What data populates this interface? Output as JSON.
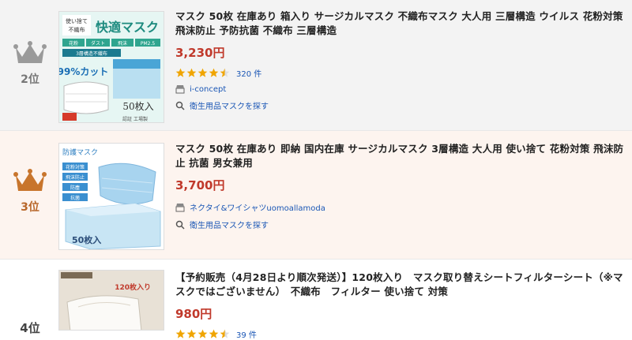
{
  "items": [
    {
      "rank_label": "2位",
      "title": "マスク 50枚 在庫あり 箱入り サージカルマスク 不織布マスク 大人用 三層構造 ウイルス 花粉対策 飛沫防止 予防抗菌 不織布 三層構造",
      "price": "3,230円",
      "rating": 4.5,
      "review_count": "320 件",
      "shop": "i-concept",
      "category_link": "衛生用品マスクを探す",
      "thumb": {
        "line1": "使い捨て",
        "line2": "不織布",
        "big": "快適マスク",
        "tags": [
          "花粉",
          "ダスト",
          "飛沫",
          "PM2.5"
        ],
        "band": "3層構造不織布",
        "percent": "99%カット",
        "count": "50枚入",
        "foot": "認証 工場製"
      }
    },
    {
      "rank_label": "3位",
      "title": "マスク 50枚 在庫あり 即納 国内在庫 サージカルマスク 3層構造 大人用 使い捨て 花粉対策 飛沫防止 抗菌 男女兼用",
      "price": "3,700円",
      "rating": 0,
      "review_count": "",
      "shop": "ネクタイ&ワイシャツuomoallamoda",
      "category_link": "衛生用品マスクを探す",
      "thumb": {
        "header": "防護マスク",
        "tags": [
          "花粉対策",
          "飛沫防止",
          "防塵",
          "抗菌"
        ],
        "count": "50枚入"
      }
    },
    {
      "rank_label": "4位",
      "title": "【予約販売（4月28日より順次発送）】120枚入り　マスク取り替えシートフィルターシート（※マスクではございません）　不織布　フィルター 使い捨て 対策",
      "price": "980円",
      "rating": 4.5,
      "review_count": "39 件",
      "thumb": {
        "count": "120枚入り"
      }
    }
  ],
  "colors": {
    "price": "#c0392b",
    "link": "#1a56b5",
    "star": "#f0a500",
    "crown_silver": "#9a9a9a",
    "crown_bronze": "#c8752c"
  }
}
